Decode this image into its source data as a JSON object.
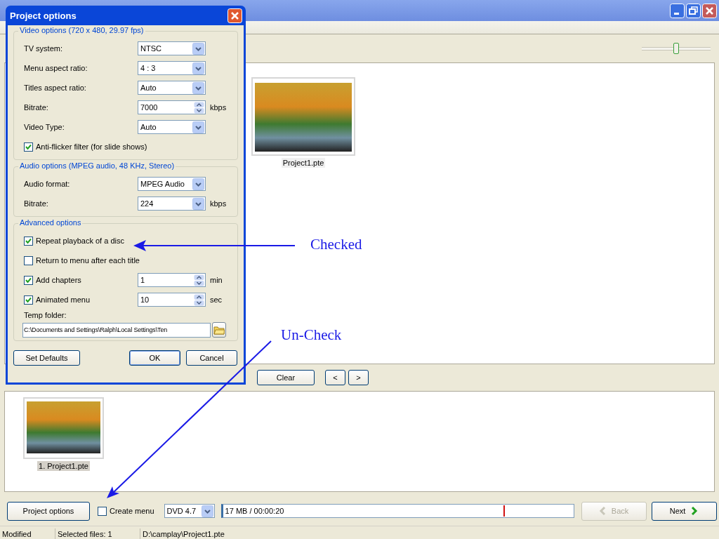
{
  "main_window": {
    "zoom_slider": {
      "level": 0.5
    },
    "slides_panel": {
      "items": [
        {
          "caption": "Project1.pte",
          "selected": false
        }
      ]
    },
    "slide_buttons": [
      "Clear",
      "<",
      ">"
    ],
    "timeline_panel": {
      "items": [
        {
          "caption": "1. Project1.pte",
          "selected": true
        }
      ]
    },
    "bottom_bar": {
      "project_options_button": "Project options",
      "create_menu": {
        "label": "Create menu",
        "checked": false
      },
      "disc_type": "DVD 4.7",
      "size_field": {
        "text": "17 MB / 00:00:20",
        "level": 0.8
      },
      "back_button": {
        "label": "Back",
        "disabled": true
      },
      "next_button": {
        "label": "Next",
        "disabled": false
      }
    },
    "status_bar": [
      "Modified",
      "Selected files: 1",
      "D:\\camplay\\Project1.pte"
    ]
  },
  "dialog": {
    "title": "Project options",
    "sections": [
      {
        "title": "Video options (720 x 480, 29.97 fps)",
        "rows": [
          {
            "kind": "select",
            "label": "TV system:",
            "value": "NTSC"
          },
          {
            "kind": "select",
            "label": "Menu aspect ratio:",
            "value": "4 : 3"
          },
          {
            "kind": "select",
            "label": "Titles aspect ratio:",
            "value": "Auto"
          },
          {
            "kind": "spin",
            "label": "Bitrate:",
            "value": "7000",
            "unit": "kbps"
          },
          {
            "kind": "select",
            "label": "Video Type:",
            "value": "Auto"
          },
          {
            "kind": "checkbox",
            "label": "Anti-flicker filter (for slide shows)",
            "checked": true
          }
        ]
      },
      {
        "title": "Audio options (MPEG audio, 48 KHz, Stereo)",
        "rows": [
          {
            "kind": "select",
            "label": "Audio format:",
            "value": "MPEG Audio"
          },
          {
            "kind": "select",
            "label": "Bitrate:",
            "value": "224",
            "unit": "kbps"
          }
        ]
      },
      {
        "title": "Advanced options",
        "rows": [
          {
            "kind": "checkbox",
            "label": "Repeat playback of a disc",
            "checked": true
          },
          {
            "kind": "checkbox",
            "label": "Return to menu after each title",
            "checked": false
          },
          {
            "kind": "checkbox_spin",
            "label": "Add chapters",
            "checked": true,
            "value": "1",
            "unit": "min"
          },
          {
            "kind": "checkbox_spin",
            "label": "Animated menu",
            "checked": true,
            "value": "10",
            "unit": "sec"
          },
          {
            "kind": "path",
            "label": "Temp folder:",
            "value": "C:\\Documents and Settings\\Ralph\\Local Settings\\Ten"
          }
        ]
      }
    ],
    "buttons": [
      {
        "kind": "left",
        "label": "Set Defaults"
      },
      {
        "kind": "default",
        "label": "OK"
      },
      {
        "kind": "normal",
        "label": "Cancel"
      }
    ]
  },
  "annotations": [
    {
      "kind": "arrow_left",
      "text": "Checked"
    },
    {
      "kind": "arrow_down_left",
      "text": "Un-Check"
    }
  ]
}
